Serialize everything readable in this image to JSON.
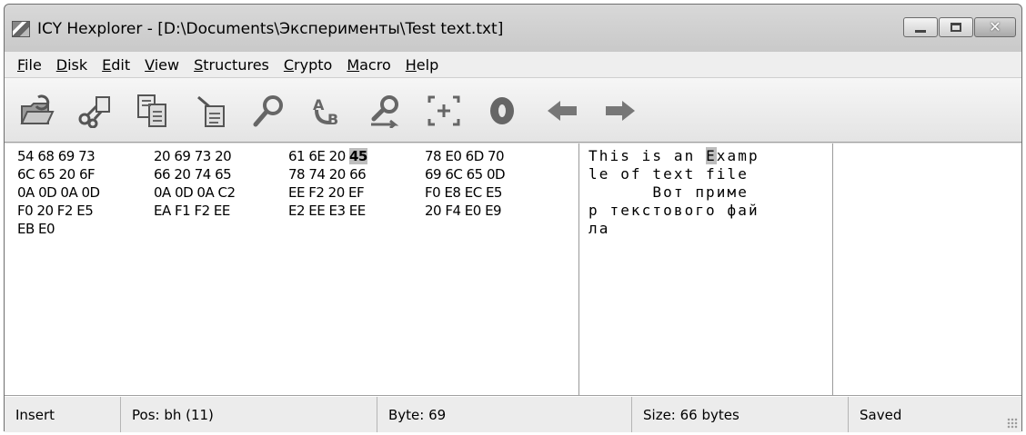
{
  "window": {
    "title": "ICY Hexplorer - [D:\\Documents\\Эксперименты\\Test text.txt]",
    "controls": {
      "minimize": "minimize-icon",
      "maximize": "maximize-icon",
      "close": "close-icon"
    }
  },
  "menu": [
    {
      "underline": "F",
      "rest": "ile"
    },
    {
      "underline": "D",
      "rest": "isk"
    },
    {
      "underline": "E",
      "rest": "dit"
    },
    {
      "underline": "V",
      "rest": "iew"
    },
    {
      "underline": "S",
      "rest": "tructures"
    },
    {
      "underline": "C",
      "rest": "rypto"
    },
    {
      "underline": "M",
      "rest": "acro"
    },
    {
      "underline": "H",
      "rest": "elp"
    }
  ],
  "toolbar": [
    "open-folder-icon",
    "cut-icon",
    "copy-icon",
    "paste-icon",
    "find-icon",
    "replace-icon",
    "find-next-icon",
    "goto-offset-icon",
    "record-icon",
    "back-arrow-icon",
    "forward-arrow-icon"
  ],
  "hex": [
    {
      "groups": [
        "54 68 69 73",
        "20 69 73 20",
        "61 6E 20 ",
        "78 E0 6D 70"
      ],
      "highlight": "45"
    },
    {
      "groups": [
        "6C 65 20 6F",
        "66 20 74 65",
        "78 74 20 66",
        "69 6C 65 0D"
      ]
    },
    {
      "groups": [
        "0A 0D 0A 0D",
        "0A 0D 0A C2",
        "EE F2 20 EF",
        "F0 E8 EC E5"
      ]
    },
    {
      "groups": [
        "F0 20 F2 E5",
        "EA F1 F2 EE",
        "E2 EE E3 EE",
        "20 F4 E0 E9"
      ]
    },
    {
      "groups": [
        "EB E0",
        "",
        "",
        ""
      ]
    }
  ],
  "text": {
    "line1_before": "This is an ",
    "line1_highlight": "E",
    "line1_after": "xamp",
    "lines": [
      "le of text file",
      "      Вот приме",
      "р текстового фай",
      "ла"
    ]
  },
  "status": {
    "mode": "Insert",
    "pos": "Pos: bh (11)",
    "byte": "Byte: 69",
    "size": "Size: 66 bytes",
    "state": "Saved"
  },
  "colors": {
    "highlight": "#bdbdbd",
    "toolbar_icon": "#6f6f6f",
    "title_bar": "#d3d3d3"
  }
}
